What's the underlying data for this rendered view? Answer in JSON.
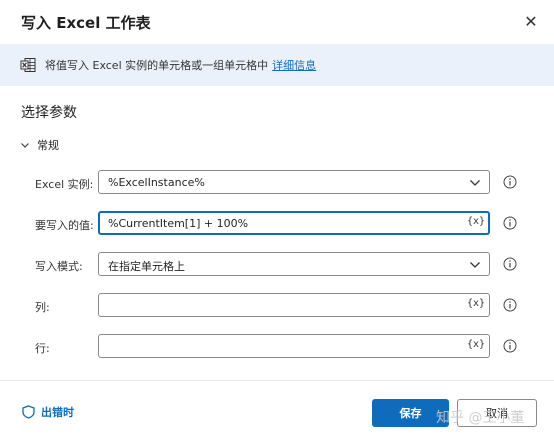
{
  "dialog": {
    "title": "写入 Excel 工作表",
    "close_glyph": "✕"
  },
  "banner": {
    "text": "将值写入 Excel 实例的单元格或一组单元格中",
    "link": "详细信息"
  },
  "section_title": "选择参数",
  "group": {
    "label": "常规"
  },
  "fields": {
    "excel_instance": {
      "label": "Excel 实例:",
      "value": "%ExcelInstance%"
    },
    "value_to_write": {
      "label": "要写入的值:",
      "value": "%CurrentItem[1] + 100%",
      "var_button": "{x}"
    },
    "write_mode": {
      "label": "写入模式:",
      "value": "在指定单元格上"
    },
    "column": {
      "label": "列:",
      "value": "",
      "var_button": "{x}"
    },
    "row": {
      "label": "行:",
      "value": "",
      "var_button": "{x}"
    }
  },
  "footer": {
    "on_error": "出错时",
    "save": "保存",
    "cancel": "取消"
  },
  "watermark": "知乎 @王小董",
  "colors": {
    "accent": "#0f6cbd",
    "banner_bg": "#eaf1fb",
    "border": "#8a8a8a"
  }
}
